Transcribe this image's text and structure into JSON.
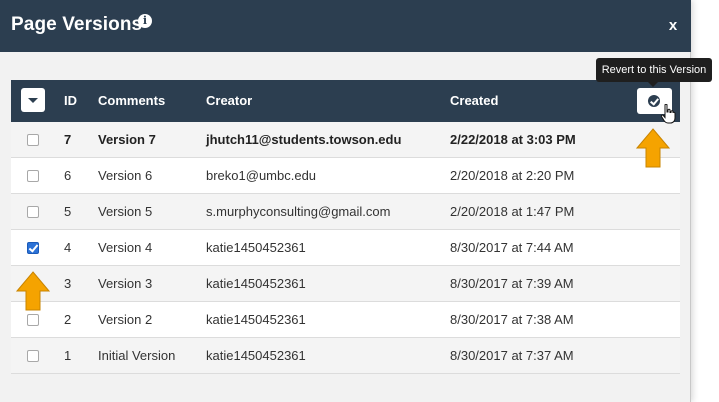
{
  "dialog": {
    "title": "Page Versions",
    "info_icon": "info-icon",
    "close_label": "x"
  },
  "tooltip": {
    "text": "Revert to this Version"
  },
  "table": {
    "columns": {
      "id": "ID",
      "comments": "Comments",
      "creator": "Creator",
      "created": "Created"
    },
    "rows": [
      {
        "id": "7",
        "comment": "Version 7",
        "creator": "jhutch11@students.towson.edu",
        "created": "2/22/2018 at 3:03 PM",
        "checked": false,
        "current": true
      },
      {
        "id": "6",
        "comment": "Version 6",
        "creator": "breko1@umbc.edu",
        "created": "2/20/2018 at 2:20 PM",
        "checked": false,
        "current": false
      },
      {
        "id": "5",
        "comment": "Version 5",
        "creator": "s.murphyconsulting@gmail.com",
        "created": "2/20/2018 at 1:47 PM",
        "checked": false,
        "current": false
      },
      {
        "id": "4",
        "comment": "Version 4",
        "creator": "katie1450452361",
        "created": "8/30/2017 at 7:44 AM",
        "checked": true,
        "current": false
      },
      {
        "id": "3",
        "comment": "Version 3",
        "creator": "katie1450452361",
        "created": "8/30/2017 at 7:39 AM",
        "checked": false,
        "current": false
      },
      {
        "id": "2",
        "comment": "Version 2",
        "creator": "katie1450452361",
        "created": "8/30/2017 at 7:38 AM",
        "checked": false,
        "current": false
      },
      {
        "id": "1",
        "comment": "Initial Version",
        "creator": "katie1450452361",
        "created": "8/30/2017 at 7:37 AM",
        "checked": false,
        "current": false
      }
    ]
  },
  "colors": {
    "header": "#2c3e50",
    "checkbox_checked": "#2b72d7",
    "arrow": "#f5a300"
  },
  "icons": {
    "select_all": "chevron-down-icon",
    "revert": "check-circle-icon",
    "cursor": "hand-pointer-icon",
    "annotation": "arrow-up-icon"
  }
}
